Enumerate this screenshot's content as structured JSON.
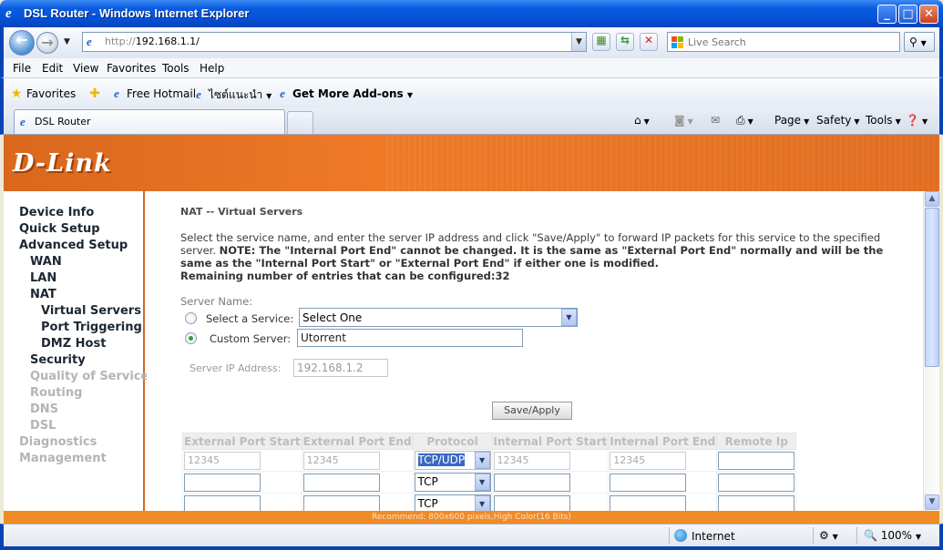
{
  "window": {
    "title": "DSL Router - Windows Internet Explorer",
    "minimize": "_",
    "maximize": "□",
    "close": "✕"
  },
  "address": {
    "url_prefix": "http://",
    "url_host": "192.168.1.1/",
    "search_placeholder": "Live Search"
  },
  "menu": [
    "File",
    "Edit",
    "View",
    "Favorites",
    "Tools",
    "Help"
  ],
  "favorites_bar": {
    "favorites_label": "Favorites",
    "links": [
      "Free Hotmail",
      "ไซต์แนะนำ",
      "Get More Add-ons"
    ]
  },
  "tab": {
    "label": "DSL Router"
  },
  "commands": [
    "Page",
    "Safety",
    "Tools"
  ],
  "banner": {
    "logo": "D-Link"
  },
  "leftnav": [
    {
      "label": "Device Info",
      "dim": false
    },
    {
      "label": "Quick Setup",
      "dim": false
    },
    {
      "label": "Advanced Setup",
      "dim": false
    },
    {
      "label": "WAN",
      "dim": false
    },
    {
      "label": "LAN",
      "dim": false
    },
    {
      "label": "NAT",
      "dim": false
    },
    {
      "label": "Virtual Servers",
      "dim": false
    },
    {
      "label": "Port Triggering",
      "dim": false
    },
    {
      "label": "DMZ Host",
      "dim": false
    },
    {
      "label": "Security",
      "dim": false
    },
    {
      "label": "Quality of Service",
      "dim": true
    },
    {
      "label": "Routing",
      "dim": true
    },
    {
      "label": "DNS",
      "dim": true
    },
    {
      "label": "DSL",
      "dim": true
    },
    {
      "label": "Diagnostics",
      "dim": true
    },
    {
      "label": "Management",
      "dim": true
    }
  ],
  "page": {
    "title": "NAT -- Virtual Servers",
    "desc_1": "Select the service name, and enter the server IP address and click \"Save/Apply\" to forward IP packets for this service to the specified server. ",
    "desc_note": "NOTE: The \"Internal Port End\" cannot be changed. It is the same as \"External Port End\" normally and will be the same as the \"Internal Port Start\" or \"External Port End\" if either one is modified.",
    "desc_remaining": "Remaining number of entries that can be configured:32",
    "server_name_label": "Server Name:",
    "select_service_label": "Select a Service:",
    "select_service_value": "Select One",
    "custom_server_label": "Custom Server:",
    "custom_server_value": "Utorrent",
    "server_ip_label": "Server IP Address:",
    "server_ip_value": "192.168.1.2",
    "save_button": "Save/Apply"
  },
  "table": {
    "headers": [
      "External Port Start",
      "External Port End",
      "Protocol",
      "Internal Port Start",
      "Internal Port End",
      "Remote Ip"
    ],
    "rows": [
      {
        "ext_start": "12345",
        "ext_end": "12345",
        "protocol": "TCP/UDP",
        "int_start": "12345",
        "int_end": "12345",
        "remote": ""
      },
      {
        "ext_start": "",
        "ext_end": "",
        "protocol": "TCP",
        "int_start": "",
        "int_end": "",
        "remote": ""
      },
      {
        "ext_start": "",
        "ext_end": "",
        "protocol": "TCP",
        "int_start": "",
        "int_end": "",
        "remote": ""
      }
    ]
  },
  "recommend": "Recommend: 800x600 pixels,High Color(16 Bits)",
  "status": {
    "zone": "Internet",
    "zoom": "100%"
  },
  "colors": {
    "dlink_orange": "#ee7a28",
    "titlebar_blue": "#0551d8"
  }
}
